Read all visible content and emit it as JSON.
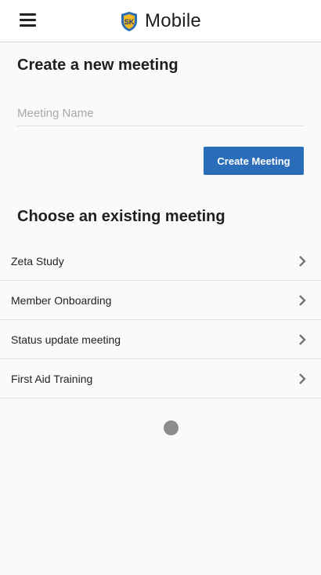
{
  "header": {
    "title": "Mobile",
    "menu_icon": "hamburger-menu-icon",
    "logo_icon": "sk-shield-logo"
  },
  "create": {
    "heading": "Create a new meeting",
    "input_placeholder": "Meeting Name",
    "input_value": "",
    "button_label": "Create Meeting"
  },
  "existing": {
    "heading": "Choose an existing meeting",
    "items": [
      {
        "label": "Zeta Study"
      },
      {
        "label": "Member Onboarding"
      },
      {
        "label": "Status update meeting"
      },
      {
        "label": "First Aid Training"
      }
    ]
  },
  "colors": {
    "accent": "#2a6db9",
    "logo_shield": "#2a6db9",
    "logo_badge": "#f2b824",
    "background": "#fafafa"
  }
}
